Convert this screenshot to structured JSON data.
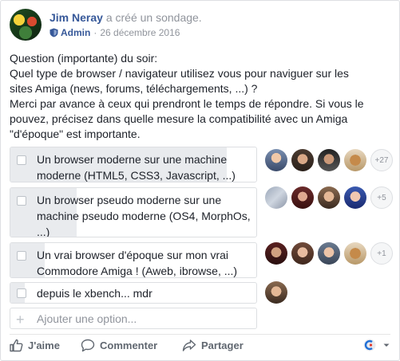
{
  "post": {
    "author": "Jim Neray",
    "action": "a créé un sondage.",
    "role": "Admin",
    "separator": "·",
    "date": "26 décembre 2016",
    "text_lines": [
      "Question (importante) du soir:",
      "Quel type de browser / navigateur utilisez vous pour naviguer sur les",
      "sites Amiga (news, forums, téléchargements, ...) ?",
      "Merci par avance à ceux qui prendront le temps de répondre. Si vous le",
      "pouvez, précisez dans quelle mesure la compatibilité avec un Amiga",
      "\"d'époque\" est importante."
    ]
  },
  "poll": {
    "options": [
      {
        "label": "Un browser moderne sur une machine moderne (HTML5, CSS3, Javascript, ...)",
        "vote_share": 0.88,
        "more": "+27"
      },
      {
        "label": "Un browser pseudo moderne sur une machine pseudo moderne (OS4, MorphOs, ...)",
        "vote_share": 0.27,
        "more": "+5"
      },
      {
        "label": "Un vrai browser d'époque sur mon vrai Commodore Amiga ! (Aweb, ibrowse, ...)",
        "vote_share": 0.14,
        "more": "+1"
      },
      {
        "label": "depuis le xbench... mdr",
        "vote_share": 0.06,
        "more": ""
      }
    ],
    "add_placeholder": "Ajouter une option..."
  },
  "actions": {
    "like": "J'aime",
    "comment": "Commenter",
    "share": "Partager"
  },
  "colors": {
    "link": "#365899",
    "muted": "#90949c",
    "bar_fill": "#e9ebee",
    "border": "#dddfe2"
  }
}
